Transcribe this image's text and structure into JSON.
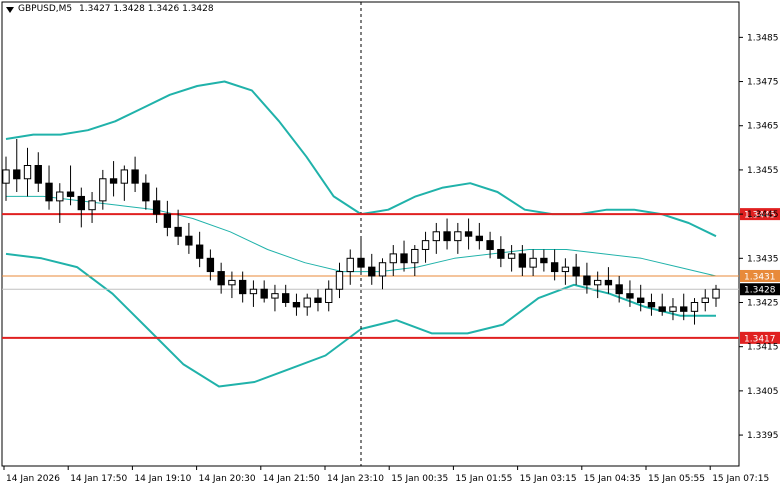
{
  "header": {
    "symbol": "GBPUSD,M5",
    "ohlc": "1.3427 1.3428 1.3426 1.3428"
  },
  "colors": {
    "background": "#ffffff",
    "candle": "#000000",
    "bollinger_outer": "#20b2aa",
    "bollinger_mid": "#20b2aa",
    "support_resistance": "#e02020",
    "price_line": "#e88a3a",
    "crosshair": "#000000"
  },
  "chart_data": {
    "type": "candlestick",
    "symbol": "GBPUSD",
    "timeframe": "M5",
    "y_axis": {
      "range": [
        1.3388,
        1.3493
      ],
      "ticks": [
        "1.3485",
        "1.3475",
        "1.3465",
        "1.3455",
        "1.3445",
        "1.3435",
        "1.3425",
        "1.3415",
        "1.3405",
        "1.3395"
      ]
    },
    "x_axis": {
      "ticks": [
        "14 Jan 2026",
        "14 Jan 17:50",
        "14 Jan 19:10",
        "14 Jan 20:30",
        "14 Jan 21:50",
        "14 Jan 23:10",
        "15 Jan 00:35",
        "15 Jan 01:55",
        "15 Jan 03:15",
        "15 Jan 04:35",
        "15 Jan 05:55",
        "15 Jan 07:15"
      ]
    },
    "horizontal_levels": [
      {
        "label": "1.3445",
        "value": 1.3445,
        "kind": "resistance"
      },
      {
        "label": "1.3417",
        "value": 1.3417,
        "kind": "support"
      },
      {
        "label": "1.3431",
        "value": 1.3431,
        "kind": "line"
      },
      {
        "label": "1.3428",
        "value": 1.3428,
        "kind": "current"
      }
    ],
    "crosshair_index": 0.5,
    "candles": [
      [
        1.3452,
        1.3458,
        1.3448,
        1.3455
      ],
      [
        1.3455,
        1.3462,
        1.345,
        1.3453
      ],
      [
        1.3453,
        1.346,
        1.3449,
        1.3456
      ],
      [
        1.3456,
        1.3459,
        1.345,
        1.3452
      ],
      [
        1.3452,
        1.3456,
        1.3446,
        1.3448
      ],
      [
        1.3448,
        1.3452,
        1.3443,
        1.345
      ],
      [
        1.345,
        1.3456,
        1.3447,
        1.3449
      ],
      [
        1.3449,
        1.3451,
        1.3442,
        1.3446
      ],
      [
        1.3446,
        1.345,
        1.3443,
        1.3448
      ],
      [
        1.3448,
        1.3455,
        1.3446,
        1.3453
      ],
      [
        1.3453,
        1.3457,
        1.3449,
        1.3452
      ],
      [
        1.3452,
        1.3456,
        1.3448,
        1.3455
      ],
      [
        1.3455,
        1.3458,
        1.345,
        1.3452
      ],
      [
        1.3452,
        1.3454,
        1.3446,
        1.3448
      ],
      [
        1.3448,
        1.3451,
        1.3443,
        1.3445
      ],
      [
        1.3445,
        1.3448,
        1.344,
        1.3442
      ],
      [
        1.3442,
        1.3446,
        1.3438,
        1.344
      ],
      [
        1.344,
        1.3443,
        1.3436,
        1.3438
      ],
      [
        1.3438,
        1.3441,
        1.3433,
        1.3435
      ],
      [
        1.3435,
        1.3437,
        1.343,
        1.3432
      ],
      [
        1.3432,
        1.3434,
        1.3427,
        1.3429
      ],
      [
        1.3429,
        1.3432,
        1.3426,
        1.343
      ],
      [
        1.343,
        1.3432,
        1.3425,
        1.3427
      ],
      [
        1.3427,
        1.343,
        1.3424,
        1.3428
      ],
      [
        1.3428,
        1.343,
        1.3425,
        1.3426
      ],
      [
        1.3426,
        1.3429,
        1.3423,
        1.3427
      ],
      [
        1.3427,
        1.3429,
        1.3424,
        1.3425
      ],
      [
        1.3425,
        1.3427,
        1.3422,
        1.3424
      ],
      [
        1.3424,
        1.3427,
        1.3422,
        1.3426
      ],
      [
        1.3426,
        1.3428,
        1.3423,
        1.3425
      ],
      [
        1.3425,
        1.343,
        1.3423,
        1.3428
      ],
      [
        1.3428,
        1.3434,
        1.3426,
        1.3432
      ],
      [
        1.3432,
        1.3437,
        1.3429,
        1.3435
      ],
      [
        1.3435,
        1.344,
        1.3432,
        1.3433
      ],
      [
        1.3433,
        1.3436,
        1.3429,
        1.3431
      ],
      [
        1.3431,
        1.3435,
        1.3428,
        1.3434
      ],
      [
        1.3434,
        1.3438,
        1.3431,
        1.3436
      ],
      [
        1.3436,
        1.3439,
        1.3432,
        1.3434
      ],
      [
        1.3434,
        1.3438,
        1.3431,
        1.3437
      ],
      [
        1.3437,
        1.3441,
        1.3434,
        1.3439
      ],
      [
        1.3439,
        1.3443,
        1.3436,
        1.3441
      ],
      [
        1.3441,
        1.3444,
        1.3437,
        1.3439
      ],
      [
        1.3439,
        1.3443,
        1.3436,
        1.3441
      ],
      [
        1.3441,
        1.3444,
        1.3437,
        1.344
      ],
      [
        1.344,
        1.3443,
        1.3437,
        1.3439
      ],
      [
        1.3439,
        1.3441,
        1.3435,
        1.3437
      ],
      [
        1.3437,
        1.344,
        1.3433,
        1.3435
      ],
      [
        1.3435,
        1.3438,
        1.3432,
        1.3436
      ],
      [
        1.3436,
        1.3438,
        1.3431,
        1.3433
      ],
      [
        1.3433,
        1.3437,
        1.3431,
        1.3435
      ],
      [
        1.3435,
        1.3437,
        1.3432,
        1.3434
      ],
      [
        1.3434,
        1.3437,
        1.343,
        1.3432
      ],
      [
        1.3432,
        1.3435,
        1.3429,
        1.3433
      ],
      [
        1.3433,
        1.3436,
        1.3429,
        1.3431
      ],
      [
        1.3431,
        1.3434,
        1.3427,
        1.3429
      ],
      [
        1.3429,
        1.3432,
        1.3426,
        1.343
      ],
      [
        1.343,
        1.3433,
        1.3427,
        1.3429
      ],
      [
        1.3429,
        1.3431,
        1.3425,
        1.3427
      ],
      [
        1.3427,
        1.343,
        1.3424,
        1.3426
      ],
      [
        1.3426,
        1.3429,
        1.3423,
        1.3425
      ],
      [
        1.3425,
        1.3427,
        1.3422,
        1.3424
      ],
      [
        1.3424,
        1.3427,
        1.3422,
        1.3423
      ],
      [
        1.3423,
        1.3426,
        1.3421,
        1.3424
      ],
      [
        1.3424,
        1.3427,
        1.3421,
        1.3423
      ],
      [
        1.3423,
        1.3426,
        1.342,
        1.3425
      ],
      [
        1.3425,
        1.3428,
        1.3423,
        1.3426
      ],
      [
        1.3426,
        1.3429,
        1.3424,
        1.3428
      ]
    ],
    "bollinger_upper": [
      1.3462,
      1.3463,
      1.3463,
      1.3464,
      1.3466,
      1.3469,
      1.3472,
      1.3474,
      1.3475,
      1.3473,
      1.3466,
      1.3458,
      1.3449,
      1.3445,
      1.3446,
      1.3449,
      1.3451,
      1.3452,
      1.345,
      1.3446,
      1.3445,
      1.3445,
      1.3446,
      1.3446,
      1.3445,
      1.3443,
      1.344
    ],
    "bollinger_mid": [
      1.3449,
      1.3449,
      1.3448,
      1.3447,
      1.3446,
      1.3444,
      1.3441,
      1.3437,
      1.3434,
      1.3432,
      1.3432,
      1.3433,
      1.3435,
      1.3436,
      1.3437,
      1.3437,
      1.3436,
      1.3435,
      1.3433,
      1.3431
    ],
    "bollinger_lower": [
      1.3436,
      1.3435,
      1.3433,
      1.3427,
      1.3419,
      1.3411,
      1.3406,
      1.3407,
      1.341,
      1.3413,
      1.3419,
      1.3421,
      1.3418,
      1.3418,
      1.342,
      1.3426,
      1.3429,
      1.3427,
      1.3424,
      1.3422,
      1.3422
    ]
  }
}
